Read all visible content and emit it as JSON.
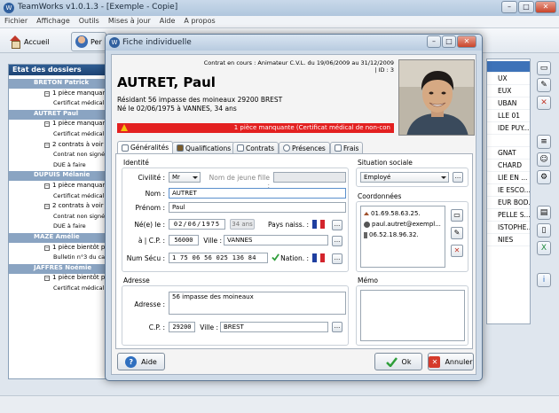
{
  "app": {
    "title": "TeamWorks v1.0.1.3 - [Exemple - Copie]",
    "menu": [
      "Fichier",
      "Affichage",
      "Outils",
      "Mises à jour",
      "Aide",
      "A propos"
    ],
    "toolbar": {
      "home_label": "Accueil",
      "persons_label": "Per"
    },
    "win_controls": {
      "minimize": "–",
      "maximize": "□",
      "close": "✕"
    }
  },
  "left_panel": {
    "title": "Etat des dossiers",
    "rows": [
      {
        "kind": "name",
        "text": "BRETON Patrick"
      },
      {
        "kind": "sub",
        "text": "1 pièce manquante"
      },
      {
        "kind": "leaf",
        "text": "Certificat médical de"
      },
      {
        "kind": "name",
        "text": "AUTRET Paul"
      },
      {
        "kind": "sub",
        "text": "1 pièce manquante"
      },
      {
        "kind": "leaf",
        "text": "Certificat médical de"
      },
      {
        "kind": "sub",
        "text": "2 contrats à voir"
      },
      {
        "kind": "leaf",
        "text": "Contrat non signé"
      },
      {
        "kind": "leaf",
        "text": "DUE à faire"
      },
      {
        "kind": "name",
        "text": "DUPUIS Mélanie"
      },
      {
        "kind": "sub",
        "text": "1 pièce manquante"
      },
      {
        "kind": "leaf",
        "text": "Certificat médical de"
      },
      {
        "kind": "sub",
        "text": "2 contrats à voir"
      },
      {
        "kind": "leaf",
        "text": "Contrat non signé"
      },
      {
        "kind": "leaf",
        "text": "DUE à faire"
      },
      {
        "kind": "name",
        "text": "MAZE Amélie"
      },
      {
        "kind": "sub",
        "text": "1 pièce bientôt périm"
      },
      {
        "kind": "leaf",
        "text": "Bulletin n°3 du casier"
      },
      {
        "kind": "name",
        "text": "JAFFRES Noémie"
      },
      {
        "kind": "sub",
        "text": "1 pièce bientôt périm"
      },
      {
        "kind": "leaf",
        "text": "Certificat médical de"
      }
    ]
  },
  "right_list": {
    "rows": [
      {
        "text": "",
        "selected": true
      },
      {
        "text": "UX",
        "selected": false
      },
      {
        "text": "EUX",
        "selected": false
      },
      {
        "text": "UBAN",
        "selected": false
      },
      {
        "text": "LLE 01",
        "selected": false
      },
      {
        "text": "IDE PUY...",
        "selected": false
      },
      {
        "text": "",
        "selected": false
      },
      {
        "text": "GNAT",
        "selected": false
      },
      {
        "text": "CHARD",
        "selected": false
      },
      {
        "text": "LIE EN ...",
        "selected": false
      },
      {
        "text": "IE ESCO...",
        "selected": false
      },
      {
        "text": "EUR BOD...",
        "selected": false
      },
      {
        "text": "PELLE S...",
        "selected": false
      },
      {
        "text": "ISTOPHE...",
        "selected": false
      },
      {
        "text": "NIES",
        "selected": false
      }
    ]
  },
  "dialog": {
    "title": "Fiche individuelle",
    "contract_info": "Contrat en cours : Animateur C.V.L. du 19/06/2009 au 31/12/2009 | ID : 3",
    "name": "AUTRET, Paul",
    "address_line": "Résidant 56 impasse des moineaux 29200 BREST",
    "birth_line": "Né le 02/06/1975 à VANNES, 34 ans",
    "alert": "1 pièce manquante (Certificat médical de non-con",
    "tabs": [
      "Généralités",
      "Qualifications",
      "Contrats",
      "Présences",
      "Frais"
    ],
    "identity": {
      "section_label": "Identité",
      "civilite_label": "Civilité :",
      "civilite_value": "Mr",
      "nom_jeune_fille_label": "Nom de jeune fille :",
      "nom_jeune_fille_value": "",
      "nom_label": "Nom :",
      "nom_value": "AUTRET",
      "prenom_label": "Prénom :",
      "prenom_value": "Paul",
      "ne_le_label": "Né(e) le :",
      "ne_le_value": "02/06/1975",
      "age_value": "34 ans",
      "pays_label": "Pays naiss. :",
      "cp_label": "à | C.P. :",
      "cp_value": "56000",
      "ville_label": "Ville :",
      "ville_value": "VANNES",
      "secu_label": "Num Sécu :",
      "secu_value": "1 75 06 56 025 136 84",
      "nation_label": "Nation. :"
    },
    "situation": {
      "section_label": "Situation sociale",
      "value": "Employé"
    },
    "coordonnees": {
      "section_label": "Coordonnées",
      "entries": [
        {
          "icon": "phone-home-icon",
          "text": "01.69.58.63.25."
        },
        {
          "icon": "email-icon",
          "text": "paul.autret@exempl..."
        },
        {
          "icon": "mobile-phone-icon",
          "text": "06.52.18.96.32."
        }
      ]
    },
    "adresse": {
      "section_label": "Adresse",
      "adresse_label": "Adresse :",
      "adresse_value": "56 impasse des moineaux",
      "cp_label": "C.P. :",
      "cp_value": "29200",
      "ville_label": "Ville :",
      "ville_value": "BREST"
    },
    "memo": {
      "section_label": "Mémo",
      "value": ""
    },
    "buttons": {
      "help": "Aide",
      "ok": "Ok",
      "cancel": "Annuler",
      "dots": "..."
    }
  },
  "colors": {
    "alert_red": "#e32020",
    "header_blue": "#1e4474",
    "selection_blue": "#3d72b8"
  }
}
